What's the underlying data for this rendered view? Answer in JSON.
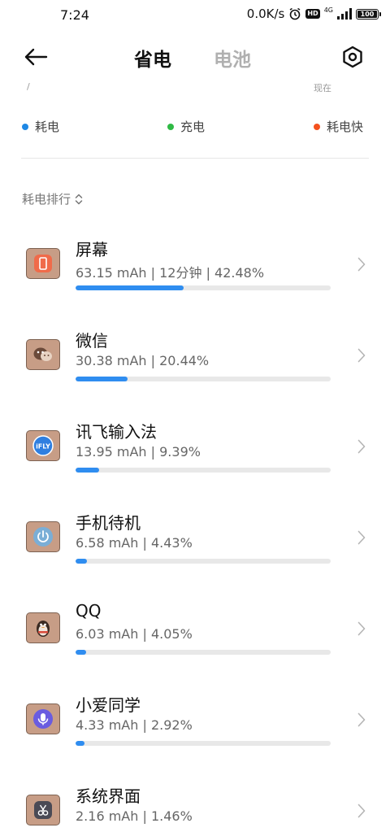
{
  "status_bar": {
    "time": "7:24",
    "net_speed": "0.0K/s",
    "hd_label": "HD",
    "network_label": "4G",
    "battery_level": "100"
  },
  "header": {
    "tab_active": "省电",
    "tab_inactive": "电池"
  },
  "chart_axis": {
    "left_label": "/",
    "right_label": "现在"
  },
  "legend": [
    {
      "label": "耗电",
      "color": "#1e88e5"
    },
    {
      "label": "充电",
      "color": "#2fba45"
    },
    {
      "label": "耗电快",
      "color": "#f4511e"
    }
  ],
  "sort": {
    "label": "耗电排行"
  },
  "apps": [
    {
      "name": "屏幕",
      "stats": "63.15 mAh | 12分钟 | 42.48%",
      "fraction": 0.4248,
      "icon": "screen-icon"
    },
    {
      "name": "微信",
      "stats": "30.38 mAh | 20.44%",
      "fraction": 0.2044,
      "icon": "wechat-icon"
    },
    {
      "name": "讯飞输入法",
      "stats": "13.95 mAh | 9.39%",
      "fraction": 0.0939,
      "icon": "ifly-icon"
    },
    {
      "name": "手机待机",
      "stats": "6.58 mAh | 4.43%",
      "fraction": 0.0443,
      "icon": "standby-power-icon"
    },
    {
      "name": "QQ",
      "stats": "6.03 mAh | 4.05%",
      "fraction": 0.0405,
      "icon": "qq-penguin-icon"
    },
    {
      "name": "小爱同学",
      "stats": "4.33 mAh | 2.92%",
      "fraction": 0.0292,
      "icon": "voice-assistant-icon"
    },
    {
      "name": "系统界面",
      "stats": "2.16 mAh | 1.46%",
      "fraction": 0.0146,
      "icon": "system-ui-icon"
    }
  ],
  "colors": {
    "accent_bar": "#2f8df0",
    "icon_tint": "#c79d86"
  }
}
